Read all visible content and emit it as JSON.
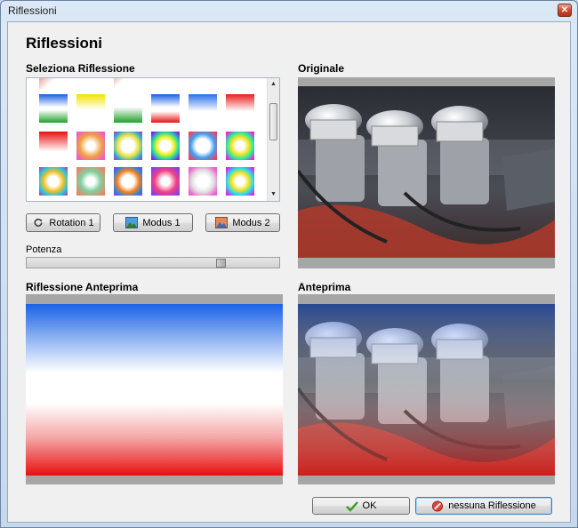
{
  "window": {
    "title": "Riflessioni",
    "close_glyph": "✕"
  },
  "page": {
    "heading": "Riflessioni"
  },
  "selector": {
    "label": "Seleziona Riflessione",
    "scroll_up": "▲",
    "scroll_down": "▼",
    "thumbnails": [
      {
        "style": "g1"
      },
      {
        "style": "g2"
      },
      {
        "style": "g3"
      },
      {
        "style": "g4"
      },
      {
        "style": "g5"
      },
      {
        "style": "g6"
      },
      {
        "style": "r1"
      },
      {
        "style": "r2"
      },
      {
        "style": "r3"
      },
      {
        "style": "r4"
      },
      {
        "style": "r5"
      },
      {
        "style": "r6"
      },
      {
        "style": "s1"
      },
      {
        "style": "s2"
      },
      {
        "style": "s3"
      },
      {
        "style": "s4"
      },
      {
        "style": "s5"
      },
      {
        "style": "s6"
      },
      {
        "style": "t1"
      },
      {
        "style": "t2"
      },
      {
        "style": "t3"
      },
      {
        "style": "t4"
      },
      {
        "style": "t5"
      },
      {
        "style": "t6"
      }
    ]
  },
  "buttons": {
    "rotation": "Rotation 1",
    "modus1": "Modus 1",
    "modus2": "Modus 2",
    "ok": "OK",
    "none": "nessuna Riflessione"
  },
  "strength": {
    "label": "Potenza",
    "value_fraction": 0.78
  },
  "original": {
    "label": "Originale"
  },
  "reflection_preview": {
    "label": "Riflessione Anteprima"
  },
  "preview": {
    "label": "Anteprima"
  },
  "colors": {
    "accent_blue": "#1a62e6",
    "accent_red": "#e81010"
  }
}
